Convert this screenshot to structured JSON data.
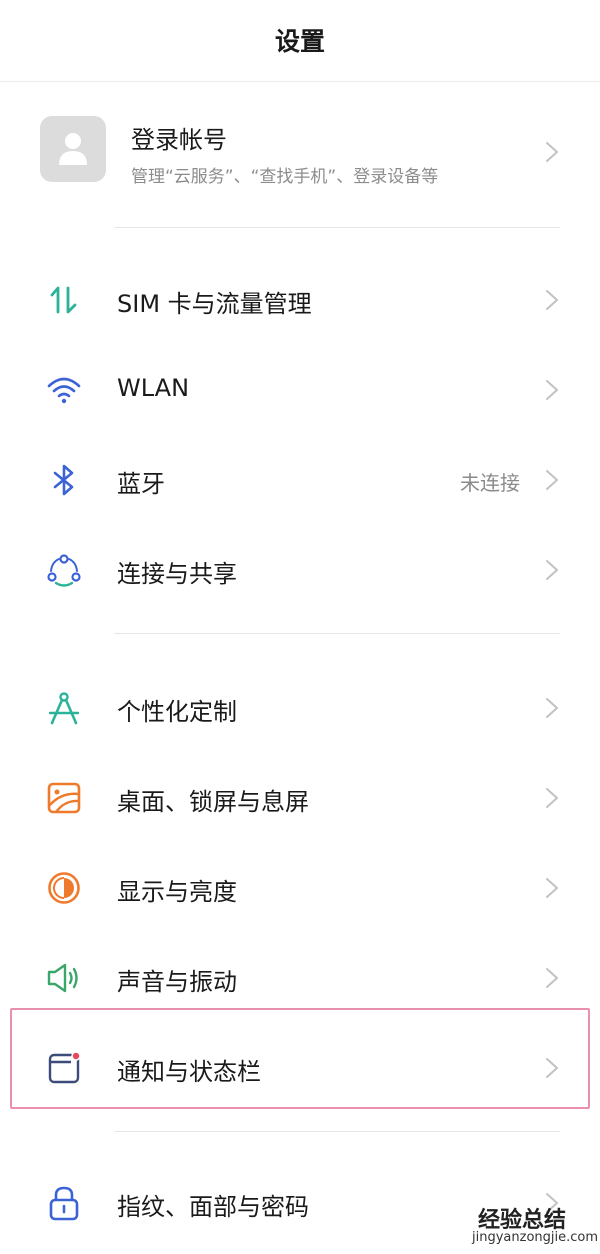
{
  "header": {
    "title": "设置"
  },
  "account": {
    "name": "登录帐号",
    "subtitle": "管理“云服务”、“查找手机”、登录设备等"
  },
  "items": [
    {
      "label": "SIM 卡与流量管理",
      "icon": "data-transfer-icon",
      "value": ""
    },
    {
      "label": "WLAN",
      "icon": "wifi-icon",
      "value": ""
    },
    {
      "label": "蓝牙",
      "icon": "bluetooth-icon",
      "value": "未连接"
    },
    {
      "label": "连接与共享",
      "icon": "connection-share-icon",
      "value": ""
    },
    {
      "label": "个性化定制",
      "icon": "compass-icon",
      "value": ""
    },
    {
      "label": "桌面、锁屏与息屏",
      "icon": "wallpaper-icon",
      "value": ""
    },
    {
      "label": "显示与亮度",
      "icon": "brightness-icon",
      "value": ""
    },
    {
      "label": "声音与振动",
      "icon": "speaker-icon",
      "value": ""
    },
    {
      "label": "通知与状态栏",
      "icon": "notification-icon",
      "value": ""
    },
    {
      "label": "指纹、面部与密码",
      "icon": "lock-icon",
      "value": ""
    }
  ],
  "colors": {
    "teal": "#2bb39a",
    "blue": "#3b63d6",
    "orange": "#f07a2c",
    "green": "#3aa66a",
    "highlight": "#e990ae"
  },
  "watermark": {
    "brand": "经验总结",
    "domain": "jingyanzongjie.com"
  }
}
